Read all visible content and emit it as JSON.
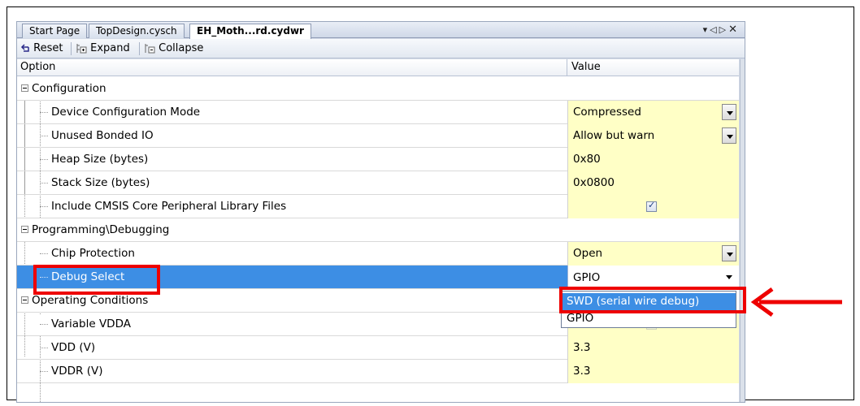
{
  "tabs": [
    {
      "label": "Start Page",
      "active": false
    },
    {
      "label": "TopDesign.cysch",
      "active": false
    },
    {
      "label": "EH_Moth...rd.cydwr",
      "active": true
    }
  ],
  "tab_controls": {
    "pin": "▾",
    "left": "◁",
    "right": "▷",
    "close": "✕"
  },
  "toolbar": {
    "reset": "Reset",
    "expand": "Expand",
    "collapse": "Collapse"
  },
  "grid": {
    "header": {
      "option": "Option",
      "value": "Value"
    },
    "groups": [
      {
        "label": "Configuration",
        "rows": [
          {
            "label": "Device Configuration Mode",
            "value": "Compressed",
            "editor": "dropdown"
          },
          {
            "label": "Unused Bonded IO",
            "value": "Allow but warn",
            "editor": "dropdown"
          },
          {
            "label": "Heap Size (bytes)",
            "value": "0x80",
            "editor": "text"
          },
          {
            "label": "Stack Size (bytes)",
            "value": "0x0800",
            "editor": "text"
          },
          {
            "label": "Include CMSIS Core Peripheral Library Files",
            "value": "",
            "editor": "checkbox",
            "checked": true
          }
        ]
      },
      {
        "label": "Programming\\Debugging",
        "rows": [
          {
            "label": "Chip Protection",
            "value": "Open",
            "editor": "dropdown"
          },
          {
            "label": "Debug Select",
            "value": "GPIO",
            "editor": "dropdown",
            "selected": true
          }
        ]
      },
      {
        "label": "Operating Conditions",
        "rows": [
          {
            "label": "Variable VDDA",
            "value": "",
            "editor": "checkbox",
            "checked": true
          },
          {
            "label": "VDD (V)",
            "value": "3.3",
            "editor": "text"
          },
          {
            "label": "VDDR (V)",
            "value": "3.3",
            "editor": "text"
          }
        ]
      }
    ]
  },
  "dropdown_popup": {
    "options": [
      "SWD (serial wire debug)",
      "GPIO"
    ],
    "highlighted": "SWD (serial wire debug)"
  },
  "colors": {
    "selection": "#3d8ee4",
    "value_cell": "#ffffc6",
    "annotation": "#ee0000"
  }
}
